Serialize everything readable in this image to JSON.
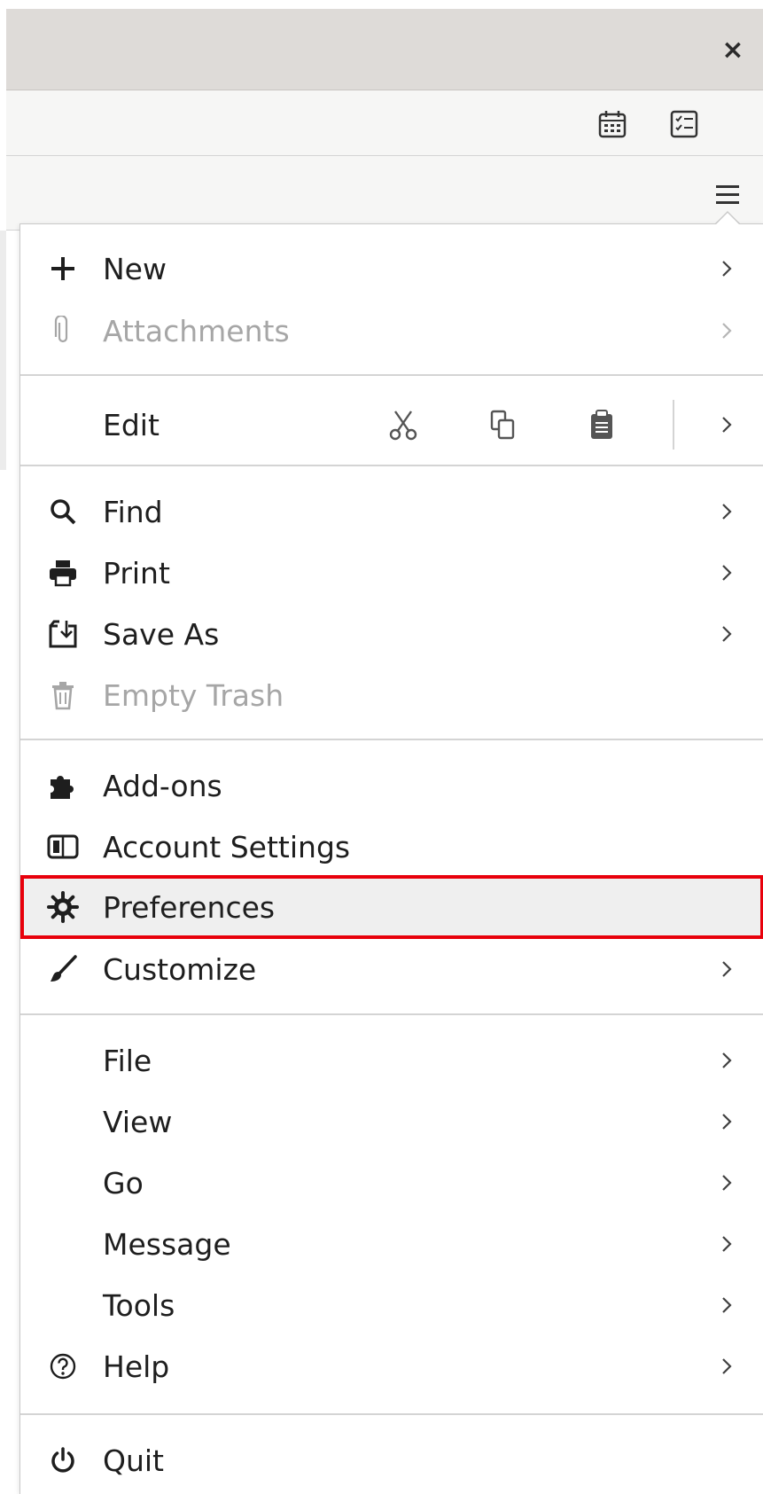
{
  "window": {
    "close_label": "×"
  },
  "toolbar": {
    "icons": [
      "calendar-icon",
      "tasks-icon",
      "hamburger-menu-icon"
    ]
  },
  "menu": {
    "new": {
      "label": "New",
      "icon": "plus-icon"
    },
    "attachments": {
      "label": "Attachments",
      "icon": "paperclip-icon",
      "disabled": true
    },
    "edit": {
      "label": "Edit",
      "tools": [
        "cut-icon",
        "copy-icon",
        "paste-icon"
      ]
    },
    "find": {
      "label": "Find",
      "icon": "search-icon"
    },
    "print": {
      "label": "Print",
      "icon": "printer-icon"
    },
    "save_as": {
      "label": "Save As",
      "icon": "save-as-icon"
    },
    "empty_trash": {
      "label": "Empty Trash",
      "icon": "trash-icon",
      "disabled": true
    },
    "addons": {
      "label": "Add-ons",
      "icon": "puzzle-icon"
    },
    "account_settings": {
      "label": "Account Settings",
      "icon": "account-icon"
    },
    "preferences": {
      "label": "Preferences",
      "icon": "gear-icon",
      "highlighted": true
    },
    "customize": {
      "label": "Customize",
      "icon": "brush-icon"
    },
    "file": {
      "label": "File"
    },
    "view": {
      "label": "View"
    },
    "go": {
      "label": "Go"
    },
    "message": {
      "label": "Message"
    },
    "tools": {
      "label": "Tools"
    },
    "help": {
      "label": "Help",
      "icon": "help-icon"
    },
    "quit": {
      "label": "Quit",
      "icon": "power-icon"
    }
  },
  "colors": {
    "highlight_border": "#e8000b",
    "disabled_text": "#a6a6a6"
  }
}
